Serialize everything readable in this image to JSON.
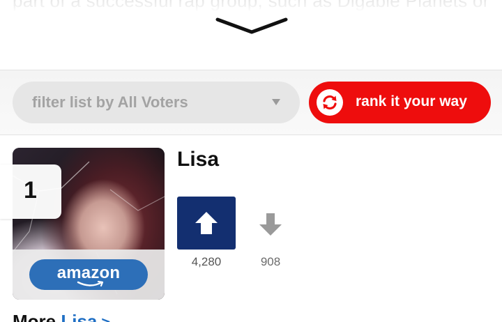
{
  "background_text": "part of a successful rap group, such as Digable Planets or",
  "filter": {
    "label": "filter list by All Voters",
    "caret_icon": "caret-down-icon"
  },
  "rank_button": {
    "label": "rank it your way",
    "icon": "sync-arrows-icon",
    "color": "#ee0d0d"
  },
  "item": {
    "rank": "1",
    "name": "Lisa",
    "amazon_label": "amazon",
    "upvotes": "4,280",
    "downvotes": "908",
    "upvote_color": "#132f70"
  },
  "more": {
    "prefix": "More",
    "link": "Lisa",
    "arrow": ">"
  }
}
